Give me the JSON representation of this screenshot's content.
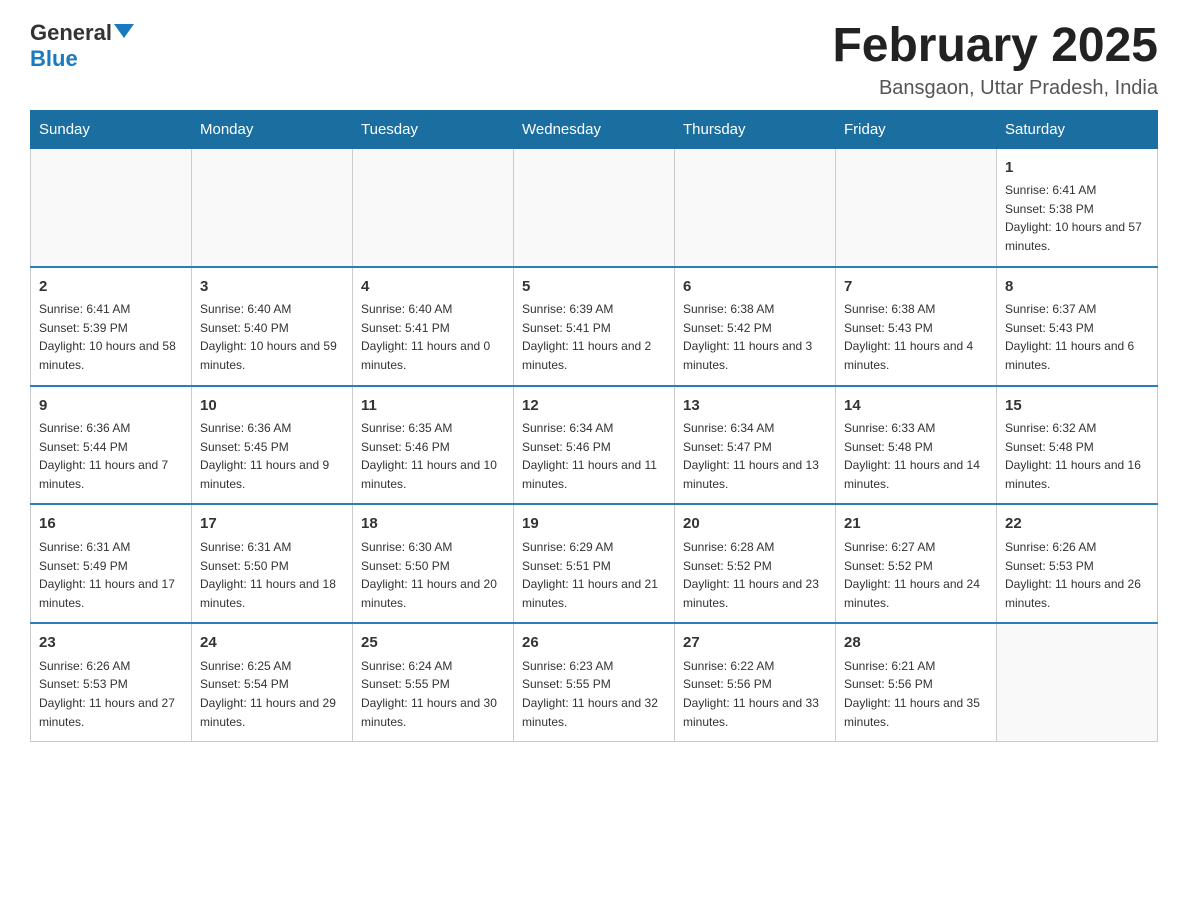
{
  "header": {
    "logo_general": "General",
    "logo_blue": "Blue",
    "month_title": "February 2025",
    "location": "Bansgaon, Uttar Pradesh, India"
  },
  "days_of_week": [
    "Sunday",
    "Monday",
    "Tuesday",
    "Wednesday",
    "Thursday",
    "Friday",
    "Saturday"
  ],
  "weeks": [
    [
      {
        "day": "",
        "info": ""
      },
      {
        "day": "",
        "info": ""
      },
      {
        "day": "",
        "info": ""
      },
      {
        "day": "",
        "info": ""
      },
      {
        "day": "",
        "info": ""
      },
      {
        "day": "",
        "info": ""
      },
      {
        "day": "1",
        "info": "Sunrise: 6:41 AM\nSunset: 5:38 PM\nDaylight: 10 hours and 57 minutes."
      }
    ],
    [
      {
        "day": "2",
        "info": "Sunrise: 6:41 AM\nSunset: 5:39 PM\nDaylight: 10 hours and 58 minutes."
      },
      {
        "day": "3",
        "info": "Sunrise: 6:40 AM\nSunset: 5:40 PM\nDaylight: 10 hours and 59 minutes."
      },
      {
        "day": "4",
        "info": "Sunrise: 6:40 AM\nSunset: 5:41 PM\nDaylight: 11 hours and 0 minutes."
      },
      {
        "day": "5",
        "info": "Sunrise: 6:39 AM\nSunset: 5:41 PM\nDaylight: 11 hours and 2 minutes."
      },
      {
        "day": "6",
        "info": "Sunrise: 6:38 AM\nSunset: 5:42 PM\nDaylight: 11 hours and 3 minutes."
      },
      {
        "day": "7",
        "info": "Sunrise: 6:38 AM\nSunset: 5:43 PM\nDaylight: 11 hours and 4 minutes."
      },
      {
        "day": "8",
        "info": "Sunrise: 6:37 AM\nSunset: 5:43 PM\nDaylight: 11 hours and 6 minutes."
      }
    ],
    [
      {
        "day": "9",
        "info": "Sunrise: 6:36 AM\nSunset: 5:44 PM\nDaylight: 11 hours and 7 minutes."
      },
      {
        "day": "10",
        "info": "Sunrise: 6:36 AM\nSunset: 5:45 PM\nDaylight: 11 hours and 9 minutes."
      },
      {
        "day": "11",
        "info": "Sunrise: 6:35 AM\nSunset: 5:46 PM\nDaylight: 11 hours and 10 minutes."
      },
      {
        "day": "12",
        "info": "Sunrise: 6:34 AM\nSunset: 5:46 PM\nDaylight: 11 hours and 11 minutes."
      },
      {
        "day": "13",
        "info": "Sunrise: 6:34 AM\nSunset: 5:47 PM\nDaylight: 11 hours and 13 minutes."
      },
      {
        "day": "14",
        "info": "Sunrise: 6:33 AM\nSunset: 5:48 PM\nDaylight: 11 hours and 14 minutes."
      },
      {
        "day": "15",
        "info": "Sunrise: 6:32 AM\nSunset: 5:48 PM\nDaylight: 11 hours and 16 minutes."
      }
    ],
    [
      {
        "day": "16",
        "info": "Sunrise: 6:31 AM\nSunset: 5:49 PM\nDaylight: 11 hours and 17 minutes."
      },
      {
        "day": "17",
        "info": "Sunrise: 6:31 AM\nSunset: 5:50 PM\nDaylight: 11 hours and 18 minutes."
      },
      {
        "day": "18",
        "info": "Sunrise: 6:30 AM\nSunset: 5:50 PM\nDaylight: 11 hours and 20 minutes."
      },
      {
        "day": "19",
        "info": "Sunrise: 6:29 AM\nSunset: 5:51 PM\nDaylight: 11 hours and 21 minutes."
      },
      {
        "day": "20",
        "info": "Sunrise: 6:28 AM\nSunset: 5:52 PM\nDaylight: 11 hours and 23 minutes."
      },
      {
        "day": "21",
        "info": "Sunrise: 6:27 AM\nSunset: 5:52 PM\nDaylight: 11 hours and 24 minutes."
      },
      {
        "day": "22",
        "info": "Sunrise: 6:26 AM\nSunset: 5:53 PM\nDaylight: 11 hours and 26 minutes."
      }
    ],
    [
      {
        "day": "23",
        "info": "Sunrise: 6:26 AM\nSunset: 5:53 PM\nDaylight: 11 hours and 27 minutes."
      },
      {
        "day": "24",
        "info": "Sunrise: 6:25 AM\nSunset: 5:54 PM\nDaylight: 11 hours and 29 minutes."
      },
      {
        "day": "25",
        "info": "Sunrise: 6:24 AM\nSunset: 5:55 PM\nDaylight: 11 hours and 30 minutes."
      },
      {
        "day": "26",
        "info": "Sunrise: 6:23 AM\nSunset: 5:55 PM\nDaylight: 11 hours and 32 minutes."
      },
      {
        "day": "27",
        "info": "Sunrise: 6:22 AM\nSunset: 5:56 PM\nDaylight: 11 hours and 33 minutes."
      },
      {
        "day": "28",
        "info": "Sunrise: 6:21 AM\nSunset: 5:56 PM\nDaylight: 11 hours and 35 minutes."
      },
      {
        "day": "",
        "info": ""
      }
    ]
  ]
}
